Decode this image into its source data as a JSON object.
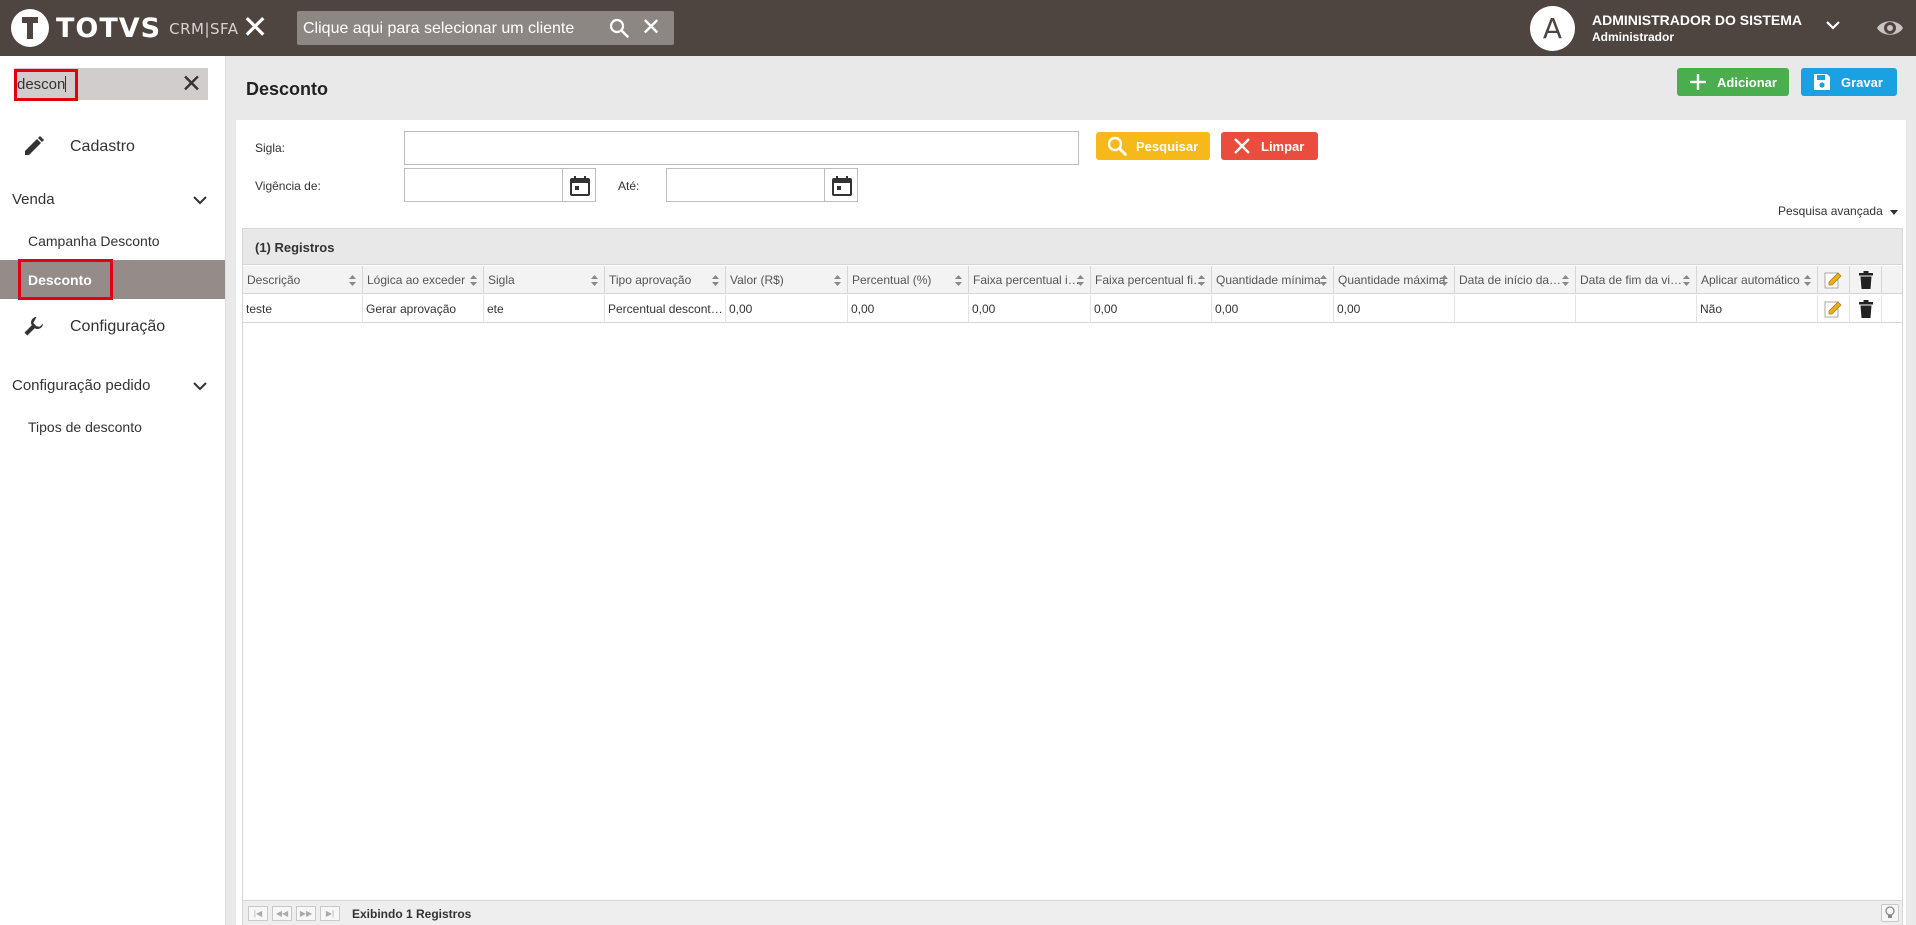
{
  "header": {
    "brand": "TOTVS",
    "product": "CRM|SFA",
    "client_placeholder": "Clique aqui para selecionar um cliente",
    "avatar_letter": "A",
    "user_name": "ADMINISTRADOR DO SISTEMA",
    "user_role": "Administrador"
  },
  "sidebar": {
    "search_value": "descon",
    "menu": {
      "cadastro": "Cadastro",
      "venda_group": "Venda",
      "campanha_desconto": "Campanha Desconto",
      "desconto": "Desconto",
      "configuracao": "Configuração",
      "config_pedido_group": "Configuração pedido",
      "tipos_desconto": "Tipos de desconto"
    }
  },
  "page": {
    "title": "Desconto",
    "add_label": "Adicionar",
    "save_label": "Gravar"
  },
  "filters": {
    "sigla_label": "Sigla:",
    "vigencia_label": "Vigência de:",
    "ate_label": "Até:",
    "search_label": "Pesquisar",
    "clear_label": "Limpar",
    "advanced_label": "Pesquisa avançada"
  },
  "grid": {
    "caption": "(1) Registros",
    "columns": [
      "Descrição",
      "Lógica ao exceder",
      "Sigla",
      "Tipo aprovação",
      "Valor (R$)",
      "Percentual (%)",
      "Faixa percentual i…",
      "Faixa percentual fi…",
      "Quantidade mínima",
      "Quantidade máxima",
      "Data de início da…",
      "Data de fim da vi…",
      "Aplicar automático"
    ],
    "rows": [
      [
        "teste",
        "Gerar aprovação",
        "ete",
        "Percentual descont…",
        "0,00",
        "0,00",
        "0,00",
        "0,00",
        "0,00",
        "0,00",
        "",
        "",
        "Não"
      ]
    ],
    "footer_text": "Exibindo 1 Registros"
  }
}
